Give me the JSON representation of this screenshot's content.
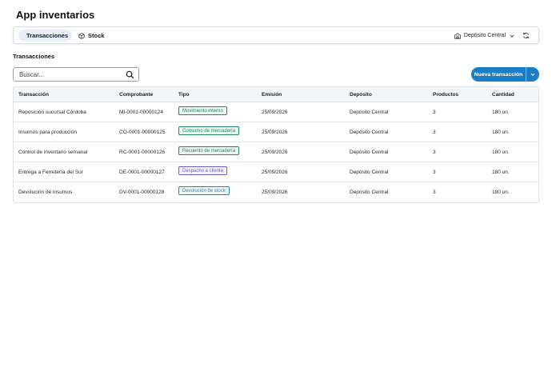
{
  "app": {
    "title": "App inventarios"
  },
  "nav": {
    "tabs": [
      {
        "label": "Transacciones",
        "icon": "document-icon",
        "active": true
      },
      {
        "label": "Stock",
        "icon": "box-icon",
        "active": false
      }
    ],
    "deposit_selector": {
      "value": "Depósito Central",
      "icon": "warehouse-icon"
    },
    "refresh_icon": "refresh-icon"
  },
  "section": {
    "title": "Transacciones"
  },
  "search": {
    "placeholder": "Buscar...",
    "value": ""
  },
  "new_button": {
    "label": "Nueva transacción",
    "color": "#1a7dc6"
  },
  "table": {
    "columns": [
      "Transacción",
      "Comprobante",
      "Tipo",
      "Emisión",
      "Depósito",
      "Productos",
      "Cantidad"
    ],
    "rows": [
      {
        "transaccion": "Reposición sucursal Córdoba",
        "comprobante": "MI-0001-00000124",
        "tipo": "Movimiento interno",
        "tipo_color": "#1f8a5a",
        "emision": "25/09/2026",
        "deposito": "Depósito Central",
        "productos": "3",
        "cantidad": "180 un."
      },
      {
        "transaccion": "Insumos para producción",
        "comprobante": "CO-0001-00000125",
        "tipo": "Consumo de mercadería",
        "tipo_color": "#1f8a5a",
        "emision": "25/09/2026",
        "deposito": "Depósito Central",
        "productos": "3",
        "cantidad": "180 un."
      },
      {
        "transaccion": "Control de inventario semanal",
        "comprobante": "RC-0001-00000126",
        "tipo": "Recuento de mercadería",
        "tipo_color": "#1f8a5a",
        "emision": "25/09/2026",
        "deposito": "Depósito Central",
        "productos": "3",
        "cantidad": "180 un."
      },
      {
        "transaccion": "Entrega a Ferretería del Sur",
        "comprobante": "DE-0001-00000127",
        "tipo": "Despacho a cliente",
        "tipo_color": "#6b5fc7",
        "emision": "25/09/2026",
        "deposito": "Depósito Central",
        "productos": "3",
        "cantidad": "180 un."
      },
      {
        "transaccion": "Devolución de insumos",
        "comprobante": "DV-0001-00000128",
        "tipo": "Devolución de stock",
        "tipo_color": "#2a8aa6",
        "emision": "25/09/2026",
        "deposito": "Depósito Central",
        "productos": "3",
        "cantidad": "180 un."
      }
    ]
  }
}
